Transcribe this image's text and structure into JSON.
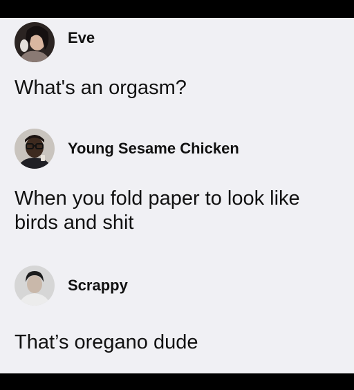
{
  "thread": {
    "posts": [
      {
        "author": "Eve",
        "text": "What's an orgasm?",
        "avatar_icon": "woman-portrait-avatar"
      },
      {
        "author": "Young Sesame Chicken",
        "text": "When you fold paper to look like birds and shit",
        "avatar_icon": "man-with-glasses-avatar"
      },
      {
        "author": "Scrappy",
        "text": "That’s oregano dude",
        "avatar_icon": "child-portrait-avatar"
      }
    ]
  },
  "colors": {
    "background": "#f0f0f4",
    "text": "#111111",
    "frame": "#000000"
  }
}
